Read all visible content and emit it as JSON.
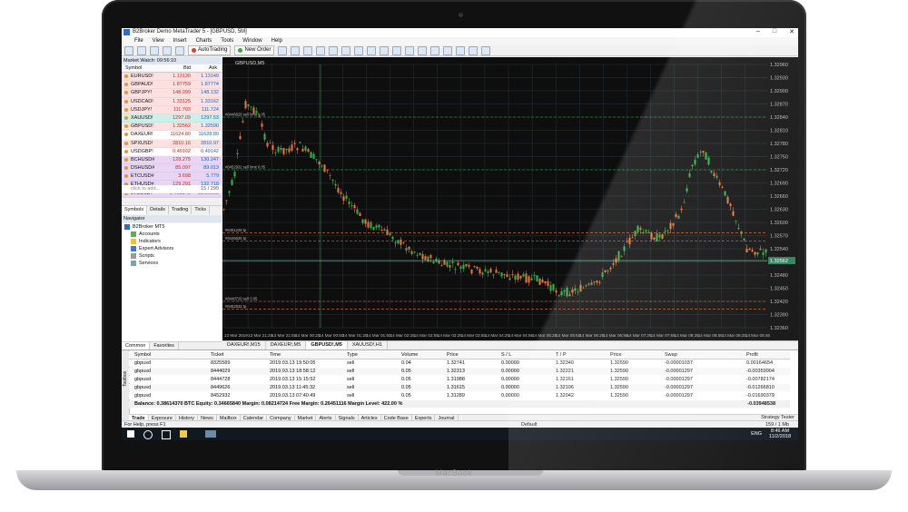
{
  "window": {
    "title": "B2Broker Demo MetaTrader 5 - [GBPUSD, 5M]",
    "controls": [
      "–",
      "□",
      "✕"
    ]
  },
  "menu": [
    "File",
    "View",
    "Insert",
    "Charts",
    "Tools",
    "Window",
    "Help"
  ],
  "toolbar": {
    "autotrading_label": "AutoTrading",
    "new_order_label": "New Order"
  },
  "market_watch": {
    "header": "Market Watch: 09:56:10",
    "columns": {
      "symbol": "Symbol",
      "bid": "Bid",
      "ask": "Ask"
    },
    "rows": [
      {
        "symbol": "EURUSD!",
        "bid": "1.13130",
        "ask": "1.13149",
        "bg": "#fde0e0"
      },
      {
        "symbol": "GBPAUD!",
        "bid": "1.87759",
        "ask": "1.87774",
        "bg": "#fde0e0"
      },
      {
        "symbol": "GBPJPY!",
        "bid": "148.099",
        "ask": "148.132",
        "bg": "#fde0e0"
      },
      {
        "symbol": "USDCAD!",
        "bid": "1.33125",
        "ask": "1.33162",
        "bg": "#fde0e0"
      },
      {
        "symbol": "USDJPY!",
        "bid": "111.703",
        "ask": "111.724",
        "bg": "#fde0e0"
      },
      {
        "symbol": "XAUUSD!",
        "bid": "1297.09",
        "ask": "1297.53",
        "bg": "#cdeee9"
      },
      {
        "symbol": "GBPUSD!",
        "bid": "1.32562",
        "ask": "1.32590",
        "bg": "#fde0e0"
      },
      {
        "symbol": "DAXEUR!",
        "bid": "11624.80",
        "ask": "11628.80",
        "bg": "#ffffff"
      },
      {
        "symbol": "SPXUSD!",
        "bid": "2810.16",
        "ask": "2810.97",
        "bg": "#fde0e0"
      },
      {
        "symbol": "USDGBP!",
        "bid": "0.49102",
        "ask": "0.49142",
        "bg": "#ffffff"
      },
      {
        "symbol": "BCHUSD#",
        "bid": "128.275",
        "ask": "130.247",
        "bg": "#e8d5f3"
      },
      {
        "symbol": "DSHUSD#",
        "bid": "85.097",
        "ask": "89.013",
        "bg": "#e8d5f3"
      },
      {
        "symbol": "ETCUSD#",
        "bid": "3.698",
        "ask": "5.779",
        "bg": "#e8d5f3"
      },
      {
        "symbol": "ETHUSD#",
        "bid": "129.291",
        "ask": "132.718",
        "bg": "#e8d5f3"
      },
      {
        "symbol": "LTCUSD#",
        "bid": "54.83340",
        "ask": "55.96660",
        "bg": "#e8d5f3"
      }
    ],
    "add_label": "click to add...",
    "count": "15 / 299",
    "tabs": [
      "Symbols",
      "Details",
      "Trading",
      "Ticks"
    ]
  },
  "navigator": {
    "header": "Navigator",
    "root": "B2Broker MT5",
    "items": [
      "Accounts",
      "Indicators",
      "Expert Advisors",
      "Scripts",
      "Services"
    ],
    "tabs": [
      "Common",
      "Favorites"
    ]
  },
  "chart": {
    "symbol_label": "GBPUSD,M5",
    "colors": {
      "bull": "#2fb344",
      "bear": "#e5743a",
      "grid": "#263238",
      "bg": "#0e0e0e"
    },
    "price_labels": [
      "1.32960",
      "1.32930",
      "1.32900",
      "1.32870",
      "1.32840",
      "1.32810",
      "1.32780",
      "1.32750",
      "1.32720",
      "1.32690",
      "1.32660",
      "1.32630",
      "1.32600",
      "1.32570",
      "1.32540",
      "1.32510",
      "1.32480",
      "1.32450",
      "1.32420",
      "1.32390",
      "1.32360"
    ],
    "current_price": "1.32562",
    "time_labels": [
      "13 Mar 2019",
      "13 Mar 21:25",
      "13 Mar 21:55",
      "14 Mar 00:20",
      "14 Mar 00:50",
      "14 Mar 01:20",
      "14 Mar 01:50",
      "14 Mar 02:25",
      "14 Mar 02:55",
      "14 Mar 03:25",
      "14 Mar 03:55",
      "14 Mar 04:25",
      "14 Mar 04:55",
      "14 Mar 05:25",
      "14 Mar 05:55",
      "14 Mar 06:25",
      "14 Mar 06:55",
      "14 Mar 07:25",
      "14 Mar 07:55",
      "14 Mar 08:25",
      "14 Mar 08:55",
      "14 Mar 09:25",
      "14 Mar 09:46"
    ],
    "level_labels": [
      "#8446828 sell limit 0.05",
      "#8452932 sell limit 0.05",
      "#8451228 tp",
      "#8446626 tp",
      "#8448729 sell 0.05",
      "#8452932 tp"
    ],
    "tabs": [
      "DAXEUR!,M15",
      "DAXEUR!,M5",
      "GBPUSD!,M5",
      "XAUUSD!,H1"
    ]
  },
  "trade": {
    "columns": [
      "Symbol",
      "Ticket",
      "Time",
      "Type",
      "Volume",
      "Price",
      "S / L",
      "T / P",
      "Price",
      "Swap",
      "Profit"
    ],
    "rows": [
      [
        "gbpusd",
        "8325589",
        "2019.03.13 19:50:05",
        "sell",
        "0.04",
        "1.32741",
        "0.00000",
        "1.32340",
        "1.32590",
        "-0.00001037",
        "0.00164654"
      ],
      [
        "gbpusd",
        "8444029",
        "2019.03.13 18:58:12",
        "sell",
        "0.05",
        "1.32313",
        "0.00000",
        "1.32221",
        "1.32590",
        "-0.00001297",
        "-0.00359904"
      ],
      [
        "gbpusd",
        "8444728",
        "2019.03.13 15:15:52",
        "sell",
        "0.05",
        "1.31988",
        "0.00000",
        "1.32161",
        "1.32590",
        "-0.00001297",
        "-0.00782174"
      ],
      [
        "gbpusd",
        "8449626",
        "2019.03.13 11:45:32",
        "sell",
        "0.05",
        "1.31615",
        "0.00000",
        "1.32106",
        "1.32590",
        "-0.00001297",
        "-0.01266810"
      ],
      [
        "gbpusd",
        "8452932",
        "2019.03.13 07:40:49",
        "sell",
        "0.05",
        "1.31289",
        "0.00000",
        "1.32042",
        "1.32590",
        "-0.00001297",
        "-0.01690379"
      ]
    ],
    "balance_line": "Balance: 0.38614370 BTC  Equity: 0.34665840  Margin: 0.08214724  Free Margin: 0.26451116  Margin Level: 422.00 %",
    "total_profit": "-0.03948538",
    "tabs": [
      "Trade",
      "Exposure",
      "History",
      "News",
      "Mailbox",
      "Calendar",
      "Company",
      "Market",
      "Alerts",
      "Signals",
      "Articles",
      "Code Base",
      "Experts",
      "Journal"
    ],
    "strategy_tester": "Strategy Tester",
    "toolbox_label": "Toolbox"
  },
  "status": {
    "help": "For Help, press F1",
    "profile": "Default",
    "connection": "159 / 1 Mb"
  },
  "taskbar": {
    "time": "8:46 AM",
    "date": "11/2/2018",
    "lang": "ENG"
  },
  "device": {
    "brand": "MacBook"
  }
}
